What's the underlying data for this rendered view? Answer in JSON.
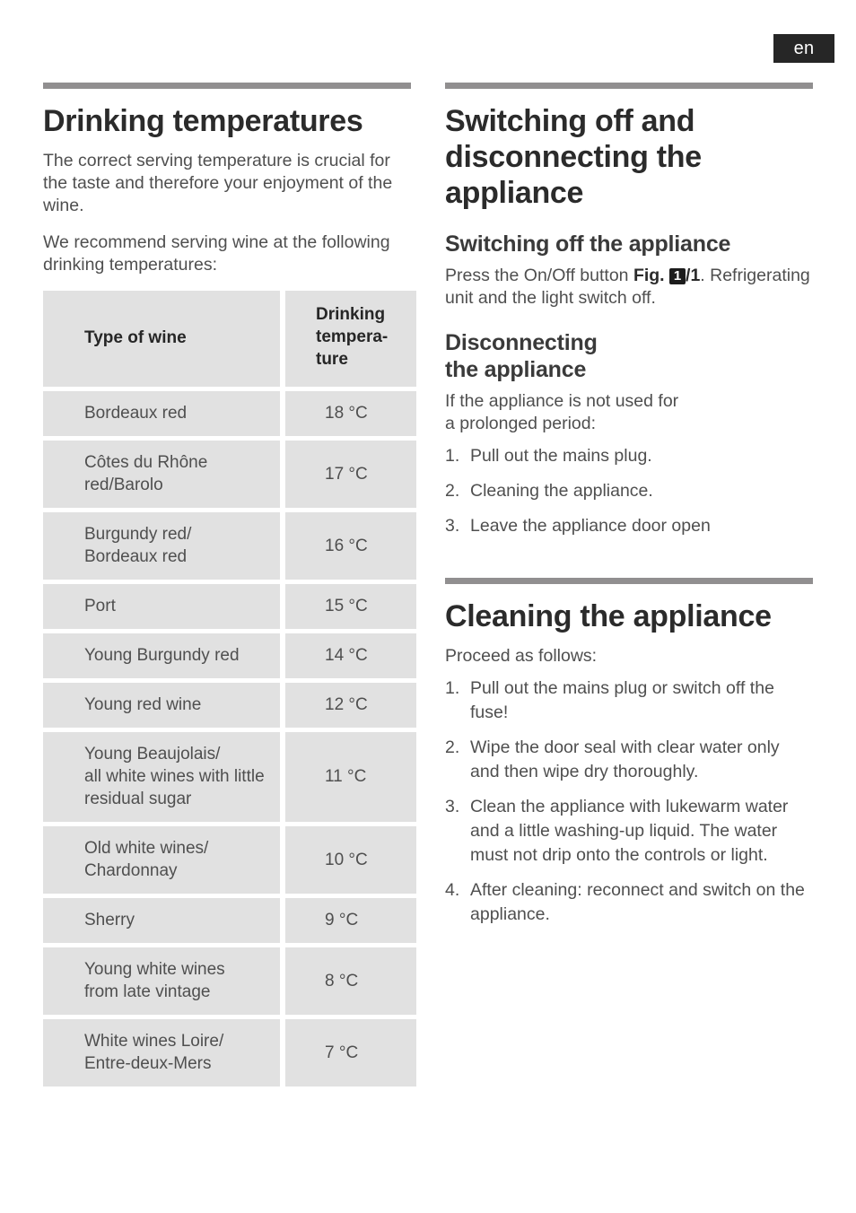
{
  "language_badge": "en",
  "left_column": {
    "heading": "Drinking temperatures",
    "paragraph_1": "The correct serving temperature is crucial for the taste and therefore your enjoyment of the wine.",
    "paragraph_2": "We recommend serving wine at the following drinking temperatures:",
    "table": {
      "headers": [
        "Type of wine",
        "Drinking\ntempera-\nture"
      ],
      "rows": [
        {
          "type": "Bordeaux red",
          "temperature": "18 °C"
        },
        {
          "type": "Côtes du Rhône\nred/Barolo",
          "temperature": "17 °C"
        },
        {
          "type": "Burgundy red/\nBordeaux red",
          "temperature": "16 °C"
        },
        {
          "type": "Port",
          "temperature": "15 °C"
        },
        {
          "type": "Young Burgundy red",
          "temperature": "14 °C"
        },
        {
          "type": "Young red wine",
          "temperature": "12 °C"
        },
        {
          "type": "Young Beaujolais/\nall white wines with little\nresidual sugar",
          "temperature": "11 °C"
        },
        {
          "type": "Old white wines/\nChardonnay",
          "temperature": "10 °C"
        },
        {
          "type": "Sherry",
          "temperature": "9 °C"
        },
        {
          "type": "Young white wines\nfrom late vintage",
          "temperature": "8 °C"
        },
        {
          "type": "White wines Loire/\nEntre-deux-Mers",
          "temperature": "7 °C"
        }
      ]
    }
  },
  "right_column": {
    "section_1": {
      "heading": "Switching off and disconnecting the appliance",
      "subheading_1": "Switching off the appliance",
      "press_text_before": "Press the On/Off button",
      "fig_label": "Fig.",
      "fig_badge": "1",
      "fig_suffix": "/1",
      "press_text_after": ". Refrigerating unit and the light switch off.",
      "subheading_2": "Disconnecting\nthe appliance",
      "intro": "If the appliance is not used for\na prolonged  period:",
      "steps": [
        {
          "number": "1.",
          "text": "Pull out the mains plug."
        },
        {
          "number": "2.",
          "text": "Cleaning  the  appliance."
        },
        {
          "number": "3.",
          "text": "Leave the appliance door open"
        }
      ]
    },
    "section_2": {
      "heading": "Cleaning the appliance",
      "intro": "Proceed  as follows:",
      "steps": [
        {
          "number": "1.",
          "text": "Pull out the mains plug or switch off the fuse!"
        },
        {
          "number": "2.",
          "text": "Wipe the door seal with clear water only and then wipe dry thoroughly."
        },
        {
          "number": "3.",
          "text": "Clean the appliance with lukewarm water and a little washing-up liquid. The water must not drip onto the controls or light."
        },
        {
          "number": "4.",
          "text": "After cleaning: reconnect and switch on the appliance."
        }
      ]
    }
  },
  "colors": {
    "rule": "#918f90",
    "cell_background": "#e1e1e1",
    "badge_background": "#262626",
    "heading": "#2b2b2b",
    "body_text": "#4f4f4f"
  }
}
